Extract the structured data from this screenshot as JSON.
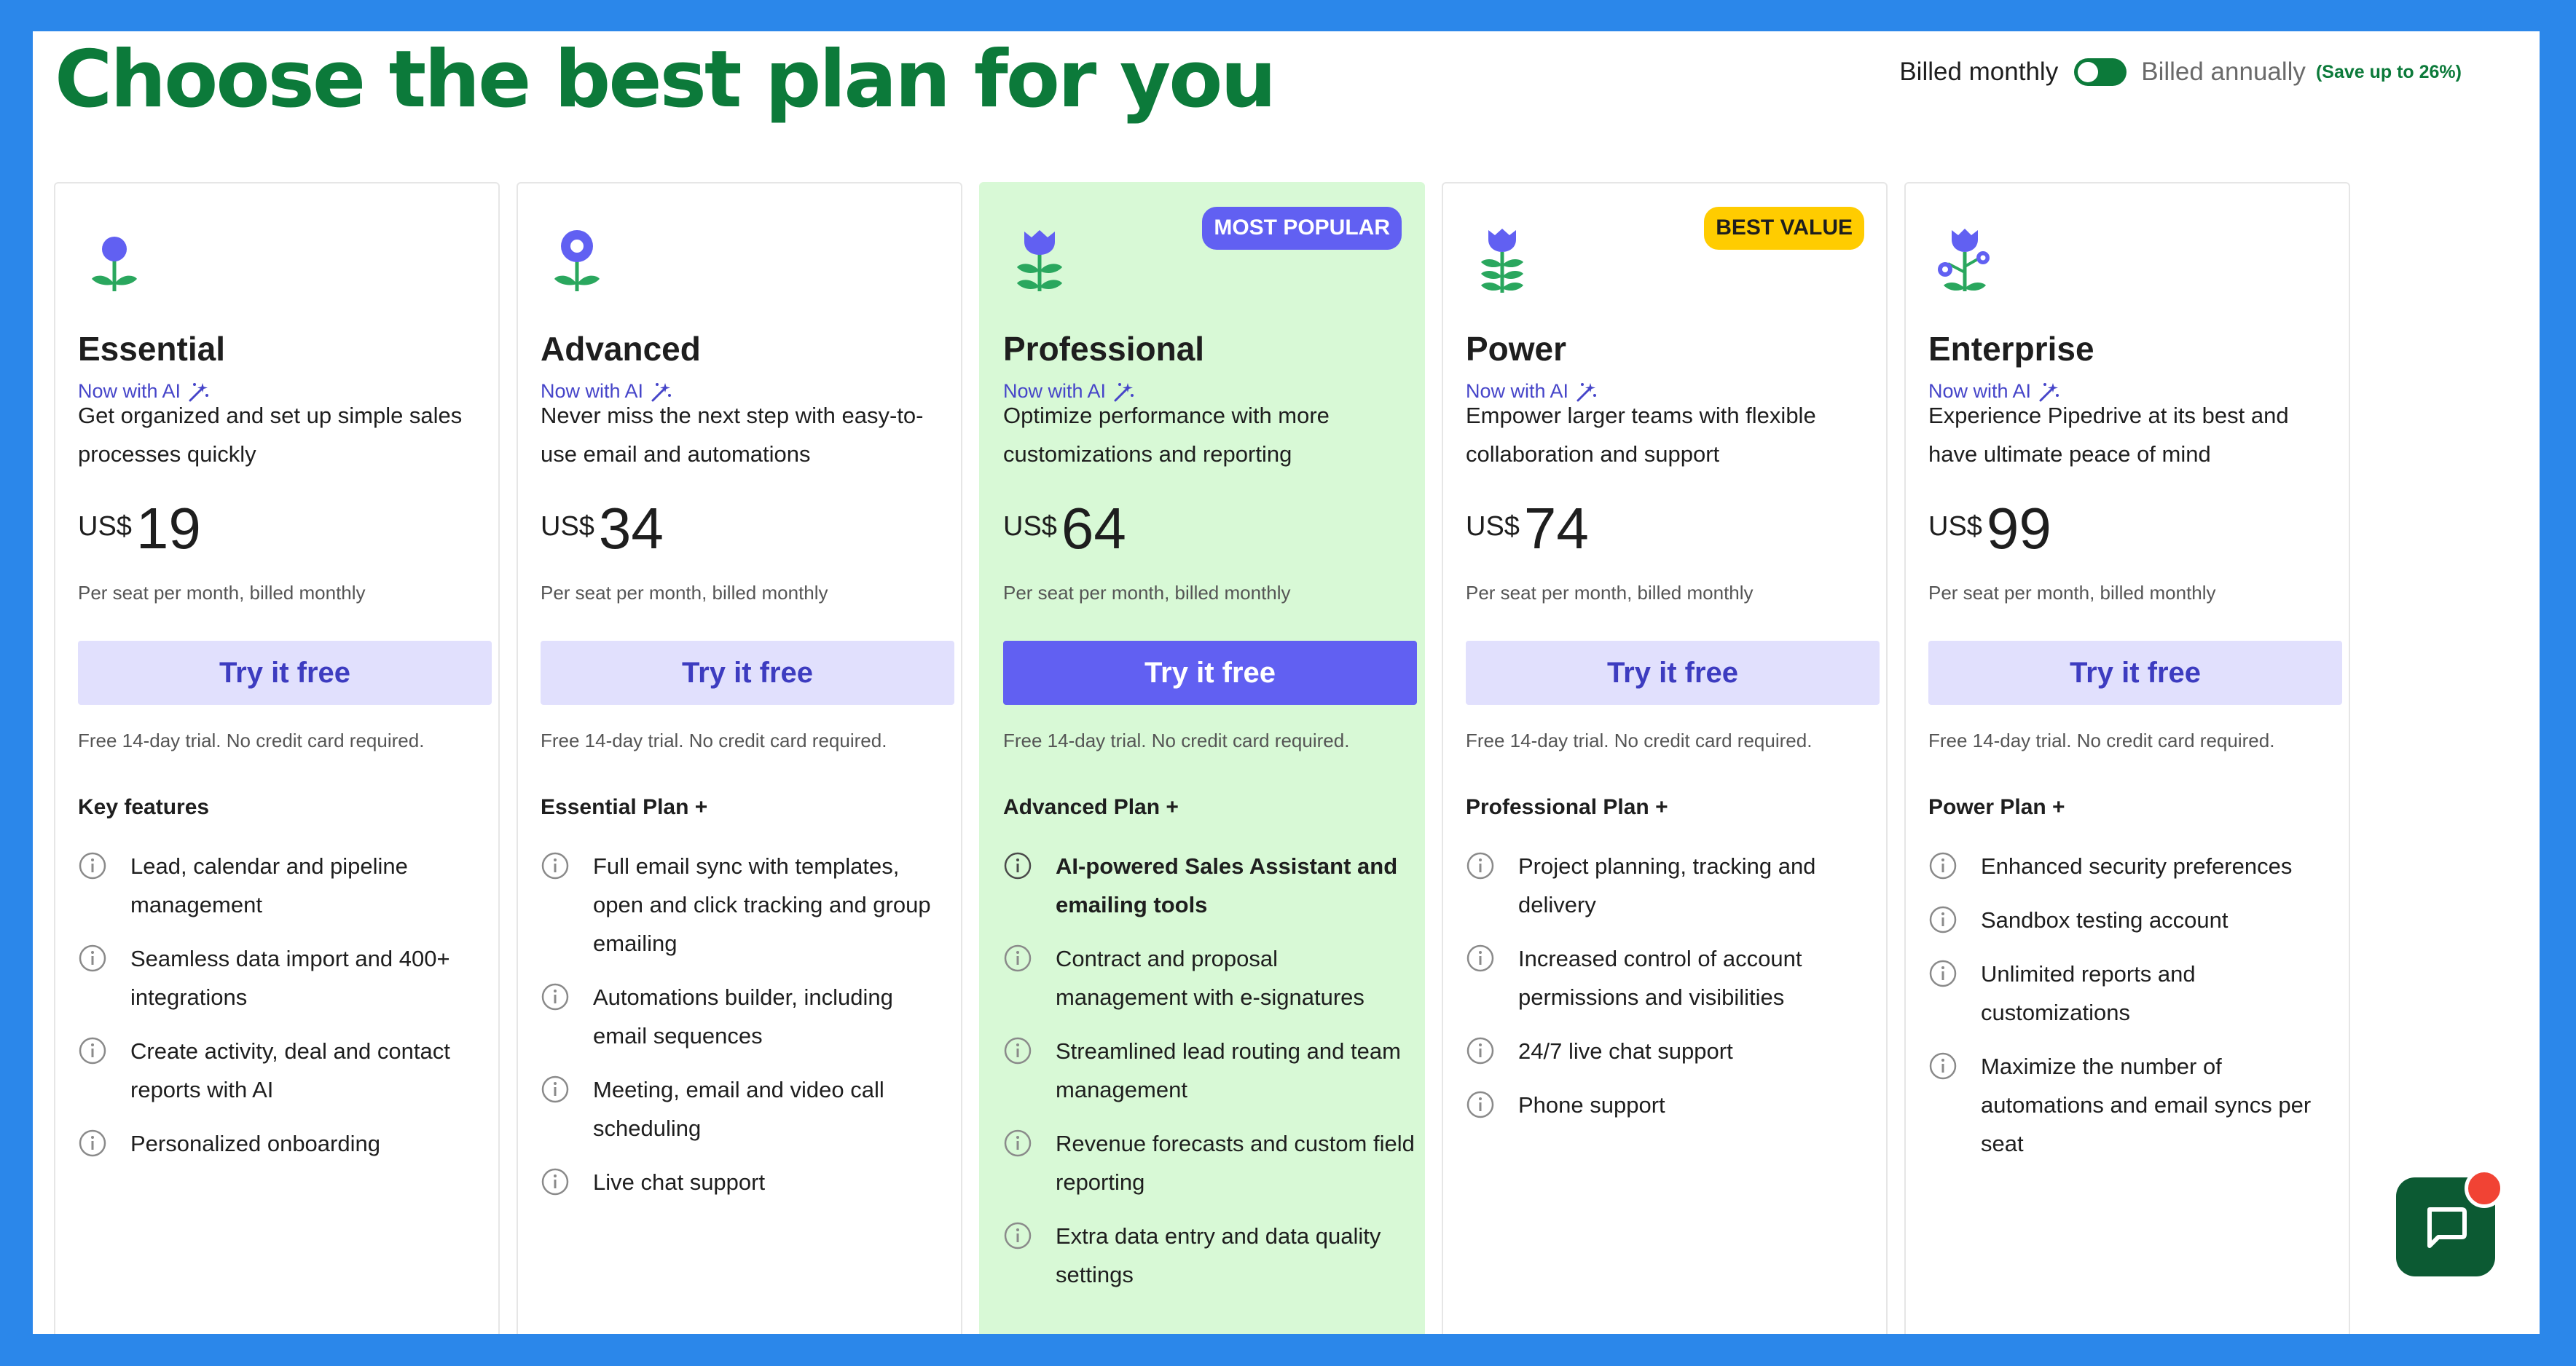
{
  "page": {
    "title": "Choose the best plan for you"
  },
  "billing": {
    "monthly_label": "Billed monthly",
    "annually_label": "Billed annually",
    "save_label": "(Save up to 26%)",
    "selected": "monthly"
  },
  "plans": [
    {
      "name": "Essential",
      "badge": "",
      "ai_label": "Now with AI",
      "description": "Get organized and set up simple sales processes quickly",
      "currency": "US$",
      "price": "19",
      "per": "Per seat per month, billed monthly",
      "cta": "Try it free",
      "trial": "Free 14-day trial. No credit card required.",
      "features_heading": "Key features",
      "features": [
        "Lead, calendar and pipeline management",
        "Seamless data import and 400+ integrations",
        "Create activity, deal and contact reports with AI",
        "Personalized onboarding"
      ]
    },
    {
      "name": "Advanced",
      "badge": "",
      "ai_label": "Now with AI",
      "description": "Never miss the next step with easy-to-use email and automations",
      "currency": "US$",
      "price": "34",
      "per": "Per seat per month, billed monthly",
      "cta": "Try it free",
      "trial": "Free 14-day trial. No credit card required.",
      "features_heading": "Essential Plan +",
      "features": [
        "Full email sync with templates, open and click tracking and group emailing",
        "Automations builder, including email sequences",
        "Meeting, email and video call scheduling",
        "Live chat support"
      ]
    },
    {
      "name": "Professional",
      "badge": "MOST POPULAR",
      "ai_label": "Now with AI",
      "description": "Optimize performance with more customizations and reporting",
      "currency": "US$",
      "price": "64",
      "per": "Per seat per month, billed monthly",
      "cta": "Try it free",
      "trial": "Free 14-day trial. No credit card required.",
      "features_heading": "Advanced Plan +",
      "features": [
        "AI-powered Sales Assistant and emailing tools",
        "Contract and proposal management with e-signatures",
        "Streamlined lead routing and team management",
        "Revenue forecasts and custom field reporting",
        "Extra data entry and data quality settings"
      ]
    },
    {
      "name": "Power",
      "badge": "BEST VALUE",
      "ai_label": "Now with AI",
      "description": "Empower larger teams with flexible collaboration and support",
      "currency": "US$",
      "price": "74",
      "per": "Per seat per month, billed monthly",
      "cta": "Try it free",
      "trial": "Free 14-day trial. No credit card required.",
      "features_heading": "Professional Plan +",
      "features": [
        "Project planning, tracking and delivery",
        "Increased control of account permissions and visibilities",
        "24/7 live chat support",
        "Phone support"
      ]
    },
    {
      "name": "Enterprise",
      "badge": "",
      "ai_label": "Now with AI",
      "description": "Experience Pipedrive at its best and have ultimate peace of mind",
      "currency": "US$",
      "price": "99",
      "per": "Per seat per month, billed monthly",
      "cta": "Try it free",
      "trial": "Free 14-day trial. No credit card required.",
      "features_heading": "Power Plan +",
      "features": [
        "Enhanced security preferences",
        "Sandbox testing account",
        "Unlimited reports and customizations",
        "Maximize the number of automations and email syncs per seat"
      ]
    }
  ],
  "colors": {
    "brand_green": "#0c7a3a",
    "accent_purple": "#6160f2",
    "featured_bg": "#d8f9d6",
    "badge_yellow": "#ffcc00",
    "background_blue": "#2b87ea"
  },
  "icons": {
    "plan_icons": [
      "flower-bud-icon",
      "flower-circle-icon",
      "tulip-icon",
      "tulip-stack-icon",
      "tulip-branches-icon"
    ],
    "ai": "magic-wand-icon",
    "feature": "info-circle-icon",
    "chat": "chat-bubble-icon"
  }
}
